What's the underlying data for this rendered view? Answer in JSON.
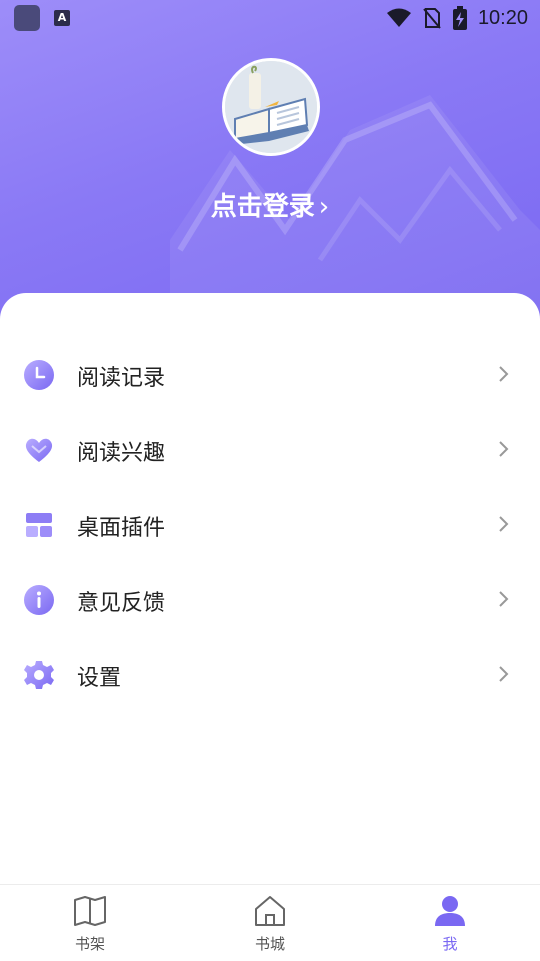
{
  "status_bar": {
    "time": "10:20",
    "app_badge": "A"
  },
  "profile": {
    "login_text": "点击登录",
    "login_arrow": "›"
  },
  "menu": {
    "items": [
      {
        "label": "阅读记录",
        "icon": "clock-icon"
      },
      {
        "label": "阅读兴趣",
        "icon": "heart-icon"
      },
      {
        "label": "桌面插件",
        "icon": "widget-icon"
      },
      {
        "label": "意见反馈",
        "icon": "info-icon"
      },
      {
        "label": "设置",
        "icon": "gear-icon"
      }
    ]
  },
  "tabbar": {
    "tabs": [
      {
        "label": "书架",
        "icon": "book-icon",
        "active": false
      },
      {
        "label": "书城",
        "icon": "home-icon",
        "active": false
      },
      {
        "label": "我",
        "icon": "person-icon",
        "active": true
      }
    ]
  },
  "colors": {
    "accent": "#7a68f2",
    "hero_start": "#9d8df9",
    "hero_end": "#7a68f2"
  }
}
